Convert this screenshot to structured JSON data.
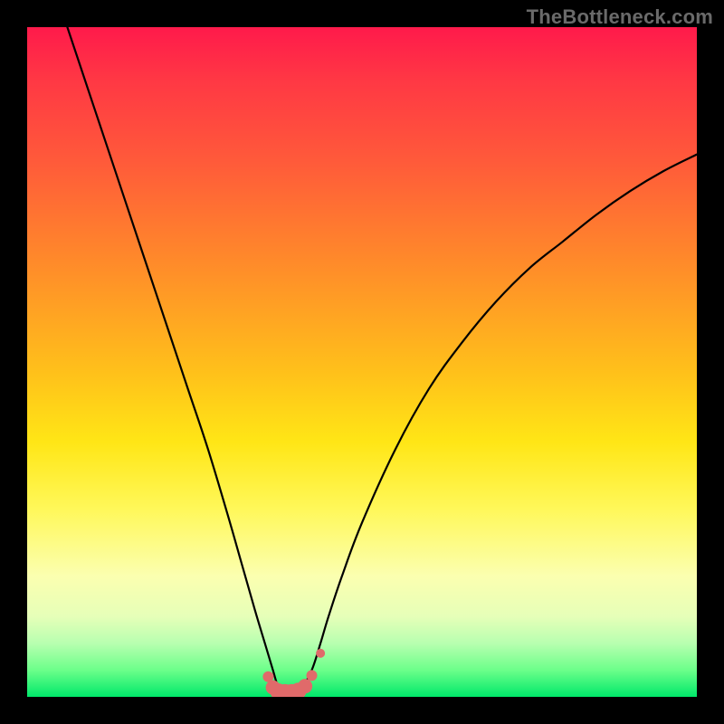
{
  "watermark": "TheBottleneck.com",
  "chart_data": {
    "type": "line",
    "title": "",
    "xlabel": "",
    "ylabel": "",
    "xlim": [
      0,
      100
    ],
    "ylim": [
      0,
      100
    ],
    "series": [
      {
        "name": "bottleneck-curve",
        "x": [
          6,
          8,
          10,
          12,
          15,
          18,
          21,
          24,
          27,
          30,
          32,
          34,
          35.5,
          36.7,
          37.5,
          38.5,
          39.5,
          41,
          42.5,
          43.8,
          45,
          47,
          50,
          55,
          60,
          65,
          70,
          75,
          80,
          85,
          90,
          95,
          100
        ],
        "y": [
          100,
          94,
          88,
          82,
          73,
          64,
          55,
          46,
          37,
          27,
          20,
          13,
          8,
          4,
          1.5,
          0.7,
          0.7,
          1.4,
          4,
          8,
          12,
          18,
          26,
          37,
          46,
          53,
          59,
          64,
          68,
          72,
          75.5,
          78.5,
          81
        ]
      }
    ],
    "markers": {
      "name": "highlight-dots",
      "color": "#e06a6a",
      "x": [
        36.0,
        36.7,
        37.5,
        38.5,
        39.5,
        40.5,
        41.5,
        42.5,
        43.8
      ],
      "y": [
        3.0,
        1.4,
        0.8,
        0.7,
        0.7,
        0.9,
        1.6,
        3.2,
        6.5
      ],
      "r": [
        6,
        8,
        9,
        9,
        9,
        9,
        8,
        6,
        5
      ]
    },
    "background_gradient_stops": [
      {
        "pos": 0.0,
        "color": "#ff1a4b"
      },
      {
        "pos": 0.2,
        "color": "#ff5a3a"
      },
      {
        "pos": 0.52,
        "color": "#ffc21a"
      },
      {
        "pos": 0.72,
        "color": "#fff85a"
      },
      {
        "pos": 0.92,
        "color": "#b8ffb0"
      },
      {
        "pos": 1.0,
        "color": "#00e86a"
      }
    ]
  }
}
